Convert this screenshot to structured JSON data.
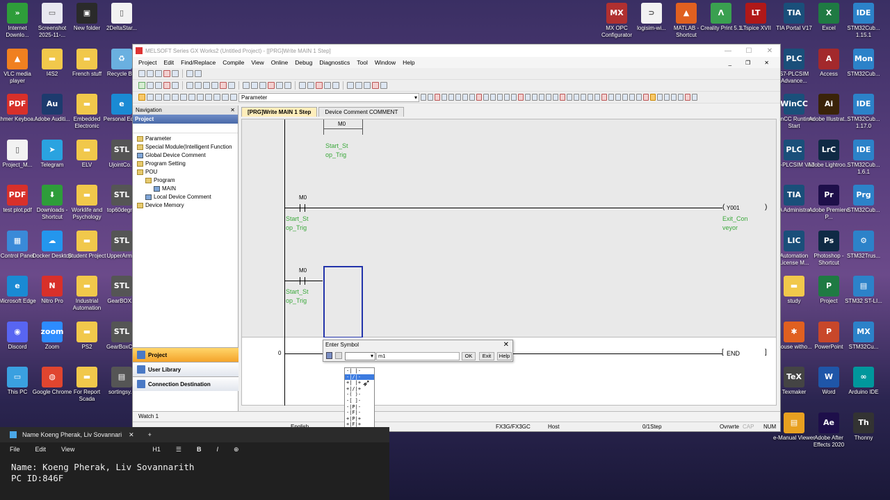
{
  "desktop_left": [
    {
      "label": "Internet Downlo...",
      "color": "#2e9d3a",
      "glyph": "»"
    },
    {
      "label": "Screenshot 2025-11-...",
      "color": "#e8e8f0",
      "glyph": "▭"
    },
    {
      "label": "New folder",
      "color": "#2a2a2a",
      "glyph": "▣"
    },
    {
      "label": "2DeltaStar...",
      "color": "#f2f2f2",
      "glyph": "▯"
    },
    {
      "label": "VLC media player",
      "color": "#f08020",
      "glyph": "▲"
    },
    {
      "label": "I4S2",
      "color": "#f1c84b",
      "glyph": "▬"
    },
    {
      "label": "French stuff",
      "color": "#f1c84b",
      "glyph": "▬"
    },
    {
      "label": "Recycle Bin",
      "color": "#6ab0e0",
      "glyph": "♻"
    },
    {
      "label": "Khmer Keyboa...",
      "color": "#d8302a",
      "glyph": "PDF"
    },
    {
      "label": "Adobe Auditi...",
      "color": "#1d3b6e",
      "glyph": "Au"
    },
    {
      "label": "Embedded Electronic",
      "color": "#f1c84b",
      "glyph": "▬"
    },
    {
      "label": "Personal Edge",
      "color": "#1a8ad4",
      "glyph": "e"
    },
    {
      "label": "Project_M...",
      "color": "#f2f2f2",
      "glyph": "▯"
    },
    {
      "label": "Telegram",
      "color": "#2aa3e0",
      "glyph": "➤"
    },
    {
      "label": "ELV",
      "color": "#f1c84b",
      "glyph": "▬"
    },
    {
      "label": "UjointCo...",
      "color": "#555",
      "glyph": "STL"
    },
    {
      "label": "test plot.pdf",
      "color": "#d8302a",
      "glyph": "PDF"
    },
    {
      "label": "Downloads - Shortcut",
      "color": "#2e9d3a",
      "glyph": "⬇"
    },
    {
      "label": "Worklife and Psychology",
      "color": "#f1c84b",
      "glyph": "▬"
    },
    {
      "label": "top60degr...",
      "color": "#555",
      "glyph": "STL"
    },
    {
      "label": "Control Panel",
      "color": "#3a8ad8",
      "glyph": "▦"
    },
    {
      "label": "Docker Desktop",
      "color": "#2496ed",
      "glyph": "☁"
    },
    {
      "label": "Student Project",
      "color": "#f1c84b",
      "glyph": "▬"
    },
    {
      "label": "UpperArm...",
      "color": "#555",
      "glyph": "STL"
    },
    {
      "label": "Microsoft Edge",
      "color": "#1a8ad4",
      "glyph": "e"
    },
    {
      "label": "Nitro Pro",
      "color": "#d8302a",
      "glyph": "N"
    },
    {
      "label": "Industrial Automation",
      "color": "#f1c84b",
      "glyph": "▬"
    },
    {
      "label": "GearBOX...",
      "color": "#555",
      "glyph": "STL"
    },
    {
      "label": "Discord",
      "color": "#5865f2",
      "glyph": "◉"
    },
    {
      "label": "Zoom",
      "color": "#2d8cff",
      "glyph": "zoom"
    },
    {
      "label": "PS2",
      "color": "#f1c84b",
      "glyph": "▬"
    },
    {
      "label": "GearBoxC...",
      "color": "#555",
      "glyph": "STL"
    },
    {
      "label": "This PC",
      "color": "#3aa0e0",
      "glyph": "▭"
    },
    {
      "label": "Google Chrome",
      "color": "#e0452f",
      "glyph": "◍"
    },
    {
      "label": "For Report Scada",
      "color": "#f1c84b",
      "glyph": "▬"
    },
    {
      "label": "sortingsy...",
      "color": "#555",
      "glyph": "▤"
    }
  ],
  "desktop_right": [
    {
      "label": "MX OPC Configurator",
      "color": "#b03030",
      "glyph": "MX"
    },
    {
      "label": "logisim-wi...",
      "color": "#f2f2f2",
      "glyph": "⊃"
    },
    {
      "label": "MATLAB - Shortcut",
      "color": "#e06020",
      "glyph": "▲"
    },
    {
      "label": "Creality Print 5.1",
      "color": "#3aa050",
      "glyph": "Λ"
    },
    {
      "label": "LTspice XVII",
      "color": "#b01818",
      "glyph": "LT"
    },
    {
      "label": "TIA Portal V17",
      "color": "#1a4f7a",
      "glyph": "TIA"
    },
    {
      "label": "Excel",
      "color": "#1f7a43",
      "glyph": "X"
    },
    {
      "label": "STM32Cub... 1.15.1",
      "color": "#2c82c9",
      "glyph": "IDE"
    },
    {
      "label": "S7-PLCSIM Advance...",
      "color": "#1a4f7a",
      "glyph": "PLC"
    },
    {
      "label": "Access",
      "color": "#a3292c",
      "glyph": "A"
    },
    {
      "label": "STM32Cub...",
      "color": "#2c82c9",
      "glyph": "Mon"
    },
    {
      "label": "WinCC Runtime Start",
      "color": "#1a4f7a",
      "glyph": "WinCC"
    },
    {
      "label": "Adobe Illustrat...",
      "color": "#3a2309",
      "glyph": "Ai"
    },
    {
      "label": "STM32Cub... 1.17.0",
      "color": "#2c82c9",
      "glyph": "IDE"
    },
    {
      "label": "S7-PLCSIM V17",
      "color": "#1a4f7a",
      "glyph": "PLC"
    },
    {
      "label": "Adobe Lightroo...",
      "color": "#102a45",
      "glyph": "LrC"
    },
    {
      "label": "STM32Cub... 1.6.1",
      "color": "#2c82c9",
      "glyph": "IDE"
    },
    {
      "label": "TIA Administra...",
      "color": "#1a4f7a",
      "glyph": "TIA"
    },
    {
      "label": "Adobe Premiere P...",
      "color": "#1e0f4a",
      "glyph": "Pr"
    },
    {
      "label": "STM32Cub...",
      "color": "#2c82c9",
      "glyph": "Prg"
    },
    {
      "label": "Automation License M...",
      "color": "#1a4f7a",
      "glyph": "LIC"
    },
    {
      "label": "Photoshop - Shortcut",
      "color": "#0f2a45",
      "glyph": "Ps"
    },
    {
      "label": "STM32Trus...",
      "color": "#2c82c9",
      "glyph": "⚙"
    },
    {
      "label": "study",
      "color": "#f1c84b",
      "glyph": "▬"
    },
    {
      "label": "Project",
      "color": "#1f7a43",
      "glyph": "P"
    },
    {
      "label": "STM32 ST-LI...",
      "color": "#2c82c9",
      "glyph": "▤"
    },
    {
      "label": "Mouse witho...",
      "color": "#e06020",
      "glyph": "✱"
    },
    {
      "label": "PowerPoint",
      "color": "#c8472a",
      "glyph": "P"
    },
    {
      "label": "STM32Cu...",
      "color": "#2c82c9",
      "glyph": "MX"
    },
    {
      "label": "Texmaker",
      "color": "#444",
      "glyph": "TeX"
    },
    {
      "label": "Word",
      "color": "#1f56a8",
      "glyph": "W"
    },
    {
      "label": "Arduino IDE",
      "color": "#00979c",
      "glyph": "∞"
    },
    {
      "label": "e-Manual Viewer",
      "color": "#e8a020",
      "glyph": "▤"
    },
    {
      "label": "Adobe After Effects 2020",
      "color": "#1e0f4a",
      "glyph": "Ae"
    },
    {
      "label": "Thonny",
      "color": "#333",
      "glyph": "Th"
    }
  ],
  "window": {
    "title": "MELSOFT Series GX Works2 (Untitled Project) - [[PRG]Write MAIN 1 Step]",
    "menu": [
      "Project",
      "Edit",
      "Find/Replace",
      "Compile",
      "View",
      "Online",
      "Debug",
      "Diagnostics",
      "Tool",
      "Window",
      "Help"
    ],
    "param_combo": "Parameter"
  },
  "nav": {
    "header": "Navigation",
    "section": "Project",
    "tree": [
      {
        "label": "Parameter",
        "indent": 0,
        "kind": "f"
      },
      {
        "label": "Special Module(Intelligent Function",
        "indent": 0,
        "kind": "f"
      },
      {
        "label": "Global Device Comment",
        "indent": 0,
        "kind": "d"
      },
      {
        "label": "Program Setting",
        "indent": 0,
        "kind": "f"
      },
      {
        "label": "POU",
        "indent": 0,
        "kind": "f"
      },
      {
        "label": "Program",
        "indent": 1,
        "kind": "f"
      },
      {
        "label": "MAIN",
        "indent": 2,
        "kind": "d"
      },
      {
        "label": "Local Device Comment",
        "indent": 1,
        "kind": "d"
      },
      {
        "label": "Device Memory",
        "indent": 0,
        "kind": "f"
      }
    ],
    "bottom": [
      "Project",
      "User Library",
      "Connection Destination"
    ]
  },
  "tabs": [
    "[PRG]Write MAIN 1 Step",
    "Device Comment COMMENT"
  ],
  "ladder": {
    "m0": "M0",
    "comment_a": "Start_St",
    "comment_b": "op_Trig",
    "coil_addr": "Y001",
    "coil_c1": "Exit_Con",
    "coil_c2": "veyor",
    "step": "0",
    "end": "END"
  },
  "dialog": {
    "title": "Enter Symbol",
    "input": "m1",
    "ok": "OK",
    "exit": "Exit",
    "help": "Help",
    "options": [
      "-| |-",
      "-|/|-",
      "+| |+",
      "+|/|+",
      "-( )-",
      "-[ ]-",
      "-|P|-",
      "-|F|-",
      "+|P|+",
      "+|F|+",
      "-P-",
      "-F-",
      "-/-"
    ],
    "selected_index": 1
  },
  "watch": "Watch 1",
  "status": {
    "lang": "English",
    "cpu": "FX3G/FX3GC",
    "host": "Host",
    "step": "0/1Step",
    "mode": "Ovrwrte",
    "cap": "CAP",
    "num": "NUM"
  },
  "note": {
    "tab_title": "Name Koeng Pherak, Liv Sovannari",
    "menu": [
      "File",
      "Edit",
      "View"
    ],
    "heading": "H1",
    "line1": "Name: Koeng Pherak, Liv Sovannarith",
    "line2": "PC ID:846F"
  }
}
